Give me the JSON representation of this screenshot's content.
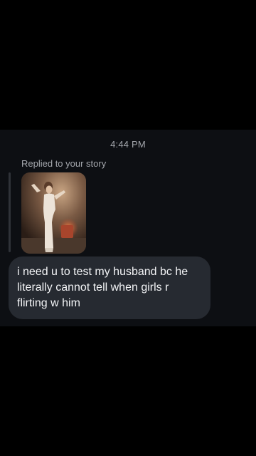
{
  "thread": {
    "timestamp": "4:44 PM",
    "reply_label": "Replied to your story",
    "message": "i need u to test my husband bc he literally cannot tell when girls r flirting w him"
  },
  "colors": {
    "background": "#000000",
    "panel": "#0d0f13",
    "bubble": "#262a31",
    "secondary_text": "#a4a7ad",
    "message_text": "#f3f4f6"
  }
}
